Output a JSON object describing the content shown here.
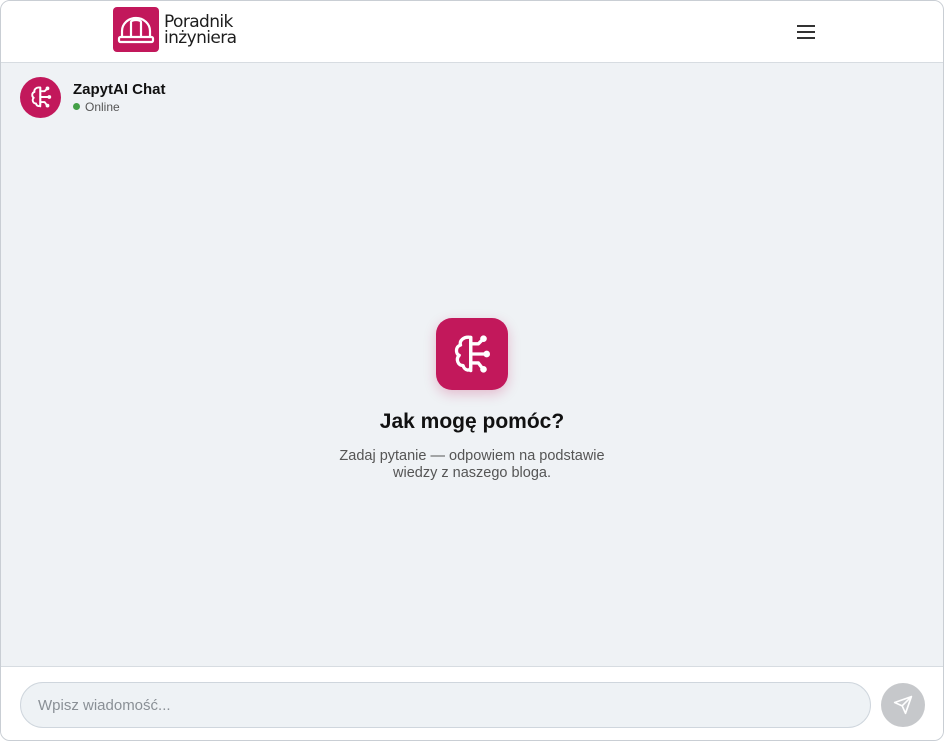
{
  "brand": {
    "line1": "Poradnik",
    "line2": "inżyniera",
    "accent_color": "#c2185b",
    "logo_icon": "hard-hat-icon"
  },
  "nav": {
    "menu_icon": "hamburger-menu-icon"
  },
  "chat": {
    "title": "ZapytAI Chat",
    "status": "Online",
    "status_color": "#43a047",
    "avatar_icon": "brain-circuit-icon"
  },
  "empty_state": {
    "icon": "brain-circuit-icon",
    "title": "Jak mogę pomóc?",
    "subtitle": "Zadaj pytanie — odpowiem na podstawie wiedzy z naszego bloga."
  },
  "composer": {
    "placeholder": "Wpisz wiadomość...",
    "value": "",
    "send_icon": "send-icon"
  }
}
